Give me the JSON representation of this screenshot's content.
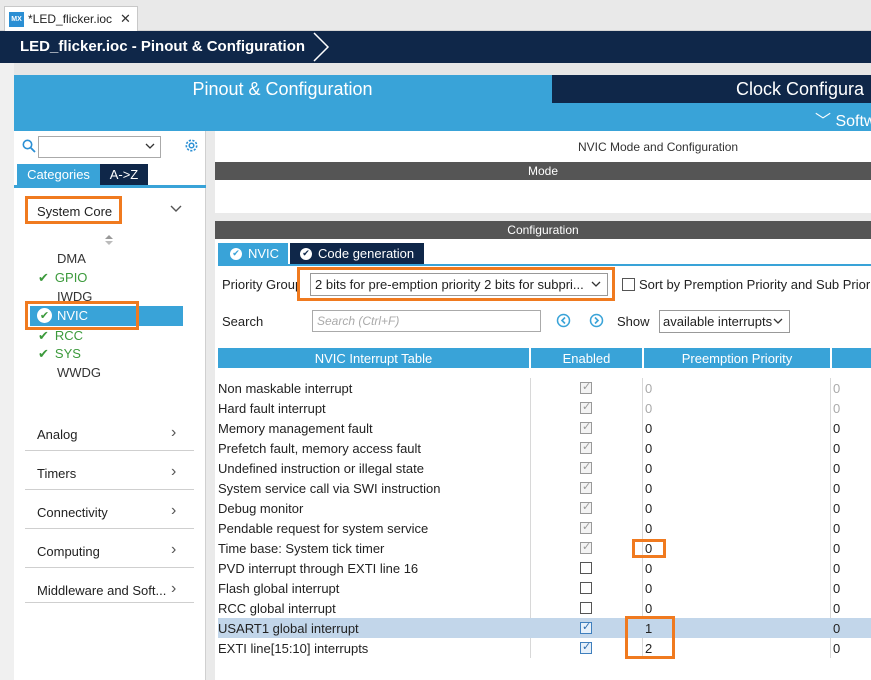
{
  "editor": {
    "file_tab": "*LED_flicker.ioc",
    "logo": "MX"
  },
  "header": {
    "breadcrumb": "LED_flicker.ioc - Pinout & Configuration"
  },
  "main_tabs": {
    "pinout": "Pinout & Configuration",
    "clock": "Clock Configura",
    "software": "Softw"
  },
  "left": {
    "search_value": "",
    "btn_categories": "Categories",
    "btn_az": "A->Z",
    "system_core": "System Core",
    "items": [
      {
        "label": "DMA",
        "checked": false
      },
      {
        "label": "GPIO",
        "checked": true
      },
      {
        "label": "IWDG",
        "checked": false
      },
      {
        "label": "NVIC",
        "checked": true
      },
      {
        "label": "RCC",
        "checked": true
      },
      {
        "label": "SYS",
        "checked": true
      },
      {
        "label": "WWDG",
        "checked": false
      }
    ],
    "groups": [
      "Analog",
      "Timers",
      "Connectivity",
      "Computing",
      "Middleware and Soft..."
    ]
  },
  "right": {
    "title": "NVIC Mode and Configuration",
    "mode_bar": "Mode",
    "config_bar": "Configuration",
    "subtab_nvic": "NVIC",
    "subtab_code": "Code generation",
    "priority_group_label": "Priority Group",
    "priority_group_value": "2 bits for pre-emption priority 2 bits for subpri...",
    "sort_label": "Sort by Premption Priority and Sub Prior",
    "search_label": "Search",
    "search_placeholder": "Search (Ctrl+F)",
    "show_label": "Show",
    "show_value": "available interrupts"
  },
  "table": {
    "headers": [
      "NVIC Interrupt Table",
      "Enabled",
      "Preemption Priority"
    ],
    "rows": [
      {
        "name": "Non maskable interrupt",
        "enabled": true,
        "fixed": true,
        "pp": "0",
        "sp": "0",
        "pp_dim": true
      },
      {
        "name": "Hard fault interrupt",
        "enabled": true,
        "fixed": true,
        "pp": "0",
        "sp": "0",
        "pp_dim": true
      },
      {
        "name": "Memory management fault",
        "enabled": true,
        "fixed": true,
        "pp": "0",
        "sp": "0",
        "pp_dim": false
      },
      {
        "name": "Prefetch fault, memory access fault",
        "enabled": true,
        "fixed": true,
        "pp": "0",
        "sp": "0",
        "pp_dim": false
      },
      {
        "name": "Undefined instruction or illegal state",
        "enabled": true,
        "fixed": true,
        "pp": "0",
        "sp": "0",
        "pp_dim": false
      },
      {
        "name": "System service call via SWI instruction",
        "enabled": true,
        "fixed": true,
        "pp": "0",
        "sp": "0",
        "pp_dim": false
      },
      {
        "name": "Debug monitor",
        "enabled": true,
        "fixed": true,
        "pp": "0",
        "sp": "0",
        "pp_dim": false
      },
      {
        "name": "Pendable request for system service",
        "enabled": true,
        "fixed": true,
        "pp": "0",
        "sp": "0",
        "pp_dim": false
      },
      {
        "name": "Time base: System tick timer",
        "enabled": true,
        "fixed": true,
        "pp": "0",
        "sp": "0",
        "pp_dim": false
      },
      {
        "name": "PVD interrupt through EXTI line 16",
        "enabled": false,
        "fixed": false,
        "pp": "0",
        "sp": "0",
        "pp_dim": false
      },
      {
        "name": "Flash global interrupt",
        "enabled": false,
        "fixed": false,
        "pp": "0",
        "sp": "0",
        "pp_dim": false
      },
      {
        "name": "RCC global interrupt",
        "enabled": false,
        "fixed": false,
        "pp": "0",
        "sp": "0",
        "pp_dim": false
      },
      {
        "name": "USART1 global interrupt",
        "enabled": true,
        "fixed": false,
        "pp": "1",
        "sp": "0",
        "pp_dim": false,
        "selected": true
      },
      {
        "name": "EXTI line[15:10] interrupts",
        "enabled": true,
        "fixed": false,
        "pp": "2",
        "sp": "0",
        "pp_dim": false
      }
    ]
  },
  "colors": {
    "accent": "#39a3d8",
    "navy": "#0f2749",
    "highlight": "#f07a1f",
    "green": "#3c9a3c"
  }
}
